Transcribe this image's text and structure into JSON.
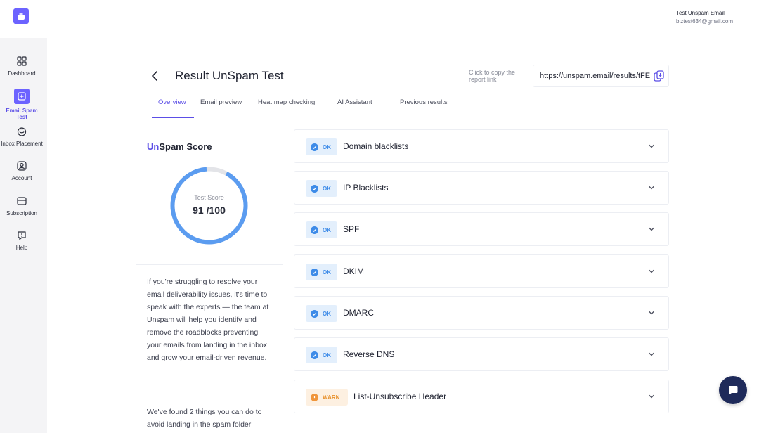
{
  "user": {
    "name": "Test Unspam Email",
    "email": "biztest634@gmail.com"
  },
  "sidebar": {
    "items": [
      {
        "label": "Dashboard",
        "icon": "grid-icon"
      },
      {
        "label": "Email Spam Test",
        "icon": "plus-square-icon",
        "active": true
      },
      {
        "label": "Inbox Placement",
        "icon": "inbox-icon"
      },
      {
        "label": "Account",
        "icon": "user-circle-icon"
      },
      {
        "label": "Subscription",
        "icon": "card-icon"
      },
      {
        "label": "Help",
        "icon": "help-bubble-icon"
      }
    ]
  },
  "header": {
    "title": "Result UnSpam Test",
    "copy_hint": "Click to copy the report link",
    "report_url": "https://unspam.email/results/tFE"
  },
  "tabs": [
    {
      "label": "Overview",
      "active": true
    },
    {
      "label": "Email preview"
    },
    {
      "label": "Heat map checking"
    },
    {
      "label": "AI Assistant"
    },
    {
      "label": "Previous results"
    }
  ],
  "score": {
    "title_prefix": "Un",
    "title_rest": "Spam Score",
    "label": "Test Score",
    "value": "91 /100",
    "fraction": 0.91
  },
  "info": {
    "text_before": "If you're struggling to resolve your email deliverability issues, it's time to speak with the experts — the team at ",
    "link": "Unspam",
    "text_after": " will help you identify and remove the roadblocks preventing your emails from landing in the inbox and grow your email-driven revenue.",
    "found": "We've found 2 things you can do to avoid landing in the spam folder"
  },
  "checks": [
    {
      "status": "OK",
      "label": "Domain blacklists"
    },
    {
      "status": "OK",
      "label": "IP Blacklists"
    },
    {
      "status": "OK",
      "label": "SPF"
    },
    {
      "status": "OK",
      "label": "DKIM"
    },
    {
      "status": "OK",
      "label": "DMARC"
    },
    {
      "status": "OK",
      "label": "Reverse DNS"
    },
    {
      "status": "WARN",
      "label": "List-Unsubscribe Header"
    }
  ],
  "colors": {
    "accent": "#5b4ee6",
    "ok": "#3d8be8",
    "warn": "#f0953a",
    "ring": "#5b9cf0",
    "ring_track": "#e3e4e8"
  }
}
